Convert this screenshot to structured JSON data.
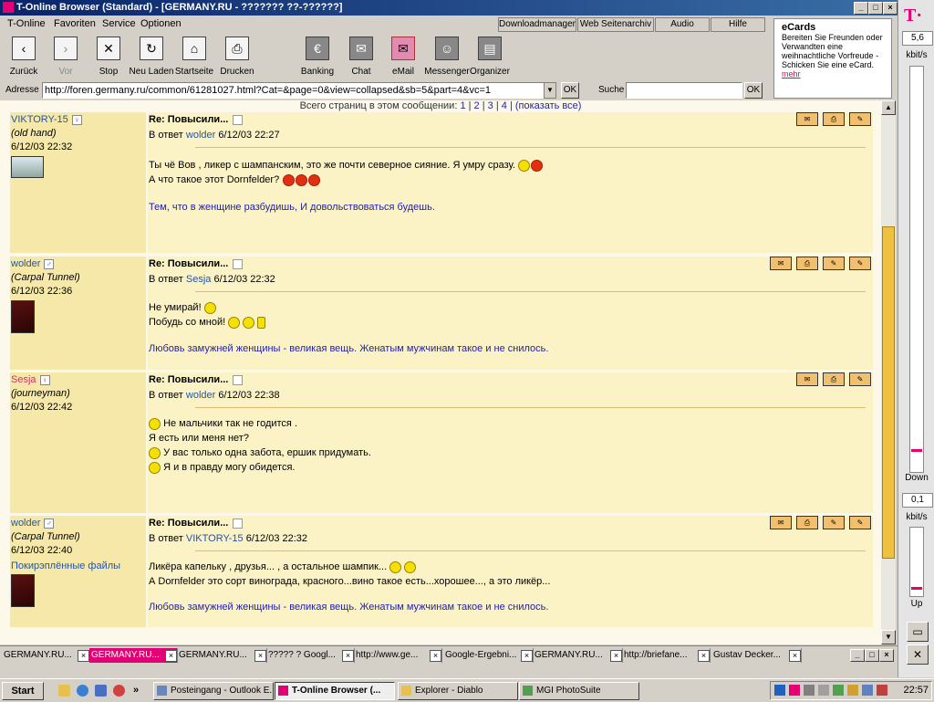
{
  "window": {
    "title": "T-Online Browser (Standard) - [GERMANY.RU - ??????? ??-??????]",
    "controls": [
      "_",
      "□",
      "×"
    ]
  },
  "menu": {
    "items": [
      "T-Online",
      "Favoriten",
      "Service",
      "Optionen"
    ],
    "tabs": [
      "Downloadmanager",
      "Web Seitenarchiv",
      "Audio",
      "Hilfe"
    ]
  },
  "toolbar": {
    "buttons": [
      {
        "label": "Zurück",
        "glyph": "‹"
      },
      {
        "label": "Vor",
        "glyph": "›"
      },
      {
        "label": "Stop",
        "glyph": "✕"
      },
      {
        "label": "Neu Laden",
        "glyph": "↻"
      },
      {
        "label": "Startseite",
        "glyph": "⌂"
      },
      {
        "label": "Drucken",
        "glyph": "⎙"
      },
      {
        "label": "Banking",
        "glyph": "€"
      },
      {
        "label": "Chat",
        "glyph": "✉"
      },
      {
        "label": "eMail",
        "glyph": "✉"
      },
      {
        "label": "Messenger",
        "glyph": "☺"
      },
      {
        "label": "Organizer",
        "glyph": "▤"
      }
    ]
  },
  "ecards": {
    "title": "eCards",
    "text": "Bereiten Sie Freunden oder Verwandten eine weihnachtliche Vorfreude - Schicken Sie eine eCard.",
    "link": "mehr"
  },
  "address": {
    "label": "Adresse",
    "url": "http://foren.germany.ru/common/61281027.html?Cat=&page=0&view=collapsed&sb=5&part=4&vc=1",
    "ok": "OK",
    "search_label": "Suche",
    "search_value": "",
    "search_ok": "OK"
  },
  "speed": {
    "down_value": "5,6",
    "down_unit": "kbit/s",
    "down_label": "Down",
    "up_value": "0,1",
    "up_unit": "kbit/s",
    "up_label": "Up",
    "down_level": 0.05,
    "up_level": 0.1
  },
  "forum": {
    "pages_prefix": "Всего страниц в этом сообщении:",
    "pages": [
      "1",
      "2",
      "3",
      "4"
    ],
    "show_all": "(показать все)",
    "posts": [
      {
        "author": "VIKTORY-15",
        "sex": "♀",
        "rank": "(old hand)",
        "date": "6/12/03 22:32",
        "title": "Re: Повысили...",
        "reply_prefix": "В ответ",
        "reply_to": "wolder",
        "reply_date": "6/12/03 22:27",
        "lines": [
          "Ты чё Вов , ликер с шампанским, это же почти северное сияние. Я умру сразу.",
          "А что такое этот Dornfelder?"
        ],
        "signature": "Тем, что в женщине разбудишь, И довольствоваться будешь.",
        "actions": [
          "✉",
          "⎙",
          "✎"
        ]
      },
      {
        "author": "wolder",
        "sex": "♂",
        "rank": "(Carpal Tunnel)",
        "date": "6/12/03 22:36",
        "title": "Re: Повысили...",
        "reply_prefix": "В ответ",
        "reply_to": "Sesja",
        "reply_date": "6/12/03 22:32",
        "lines": [
          "Не умирай!",
          "Побудь со мной!"
        ],
        "signature": "Любовь замужней женщины - великая вещь. Женатым мужчинам такое и не снилось.",
        "actions": [
          "✉",
          "⎙",
          "✎",
          "✎"
        ]
      },
      {
        "author": "Sesja",
        "sex": "♀",
        "rank": "(journeyman)",
        "date": "6/12/03 22:42",
        "title": "Re: Повысили...",
        "reply_prefix": "В ответ",
        "reply_to": "wolder",
        "reply_date": "6/12/03 22:38",
        "lines": [
          "Не мальчики так не годится .",
          "Я есть или меня нет?",
          "У вас только одна забота, ершик придумать.",
          "Я и в правду могу обидется."
        ],
        "signature": "",
        "actions": [
          "✉",
          "⎙",
          "✎"
        ]
      },
      {
        "author": "wolder",
        "sex": "♂",
        "rank": "(Carpal Tunnel)",
        "date": "6/12/03 22:40",
        "special": "Покирэплённые файлы",
        "title": "Re: Повысили...",
        "reply_prefix": "В ответ",
        "reply_to": "VIKTORY-15",
        "reply_date": "6/12/03 22:32",
        "lines": [
          "Ликёра капельку , друзья... , а остальное шампик...",
          "А Dornfelder это сорт винограда, красного...вино такое есть...хорошее..., а это ликёр..."
        ],
        "signature": "Любовь замужней женщины - великая вещь. Женатым мужчинам такое и не снилось.",
        "actions": [
          "✉",
          "⎙",
          "✎",
          "✎"
        ]
      }
    ]
  },
  "bottom_tabs": [
    {
      "label": "GERMANY.RU...",
      "active": false
    },
    {
      "label": "GERMANY.RU...",
      "active": true
    },
    {
      "label": "GERMANY.RU...",
      "active": false
    },
    {
      "label": "????? ? Googl...",
      "active": false
    },
    {
      "label": "http://www.ge...",
      "active": false
    },
    {
      "label": "Google-Ergebni...",
      "active": false
    },
    {
      "label": "GERMANY.RU...",
      "active": false
    },
    {
      "label": "http://briefane...",
      "active": false
    },
    {
      "label": "Gustav Decker...",
      "active": false
    }
  ],
  "taskbar": {
    "start": "Start",
    "tasks": [
      {
        "label": "Posteingang - Outlook E...",
        "active": false
      },
      {
        "label": "T-Online Browser (...",
        "active": true
      },
      {
        "label": "Explorer - Diablo",
        "active": false
      },
      {
        "label": "MGI PhotoSuite",
        "active": false
      }
    ],
    "clock": "22:57"
  },
  "colors": {
    "brand": "#e20074",
    "post_side": "#f6e8a8",
    "post_body": "#fbf3c6",
    "link": "#2255aa"
  }
}
